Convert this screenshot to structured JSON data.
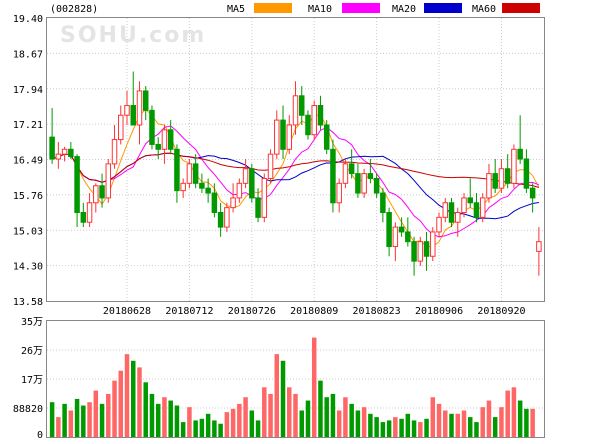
{
  "chart_data": [
    {
      "type": "candlestick",
      "code": "(002828)",
      "watermark": "SOHU.com",
      "legend": [
        {
          "name": "MA5",
          "color": "#ff9900"
        },
        {
          "name": "MA10",
          "color": "#ff00ff"
        },
        {
          "name": "MA20",
          "color": "#0000cc"
        },
        {
          "name": "MA60",
          "color": "#cc0000"
        }
      ],
      "ylim": [
        13.58,
        19.4
      ],
      "y_ticks": [
        "19.40",
        "18.67",
        "17.94",
        "17.21",
        "16.49",
        "15.76",
        "15.03",
        "14.30",
        "13.58"
      ],
      "x_tick_labels": [
        "20180628",
        "20180712",
        "20180726",
        "20180809",
        "20180823",
        "20180906",
        "20180920"
      ],
      "x_tick_index": [
        12,
        22,
        32,
        42,
        52,
        62,
        72
      ],
      "up_color": "#ff3333",
      "down_color": "#009900",
      "candles": [
        [
          16.95,
          17.55,
          16.4,
          16.5
        ],
        [
          16.5,
          16.85,
          16.3,
          16.6
        ],
        [
          16.6,
          16.75,
          16.45,
          16.7
        ],
        [
          16.7,
          16.85,
          16.5,
          16.55
        ],
        [
          16.55,
          16.6,
          15.1,
          15.4
        ],
        [
          15.4,
          15.6,
          15.1,
          15.2
        ],
        [
          15.2,
          15.8,
          15.1,
          15.6
        ],
        [
          15.6,
          16.0,
          15.4,
          15.95
        ],
        [
          15.95,
          16.2,
          15.5,
          15.7
        ],
        [
          15.7,
          16.5,
          15.6,
          16.4
        ],
        [
          16.4,
          17.2,
          16.3,
          16.9
        ],
        [
          16.9,
          17.6,
          16.8,
          17.4
        ],
        [
          17.4,
          17.9,
          17.2,
          17.6
        ],
        [
          17.6,
          18.3,
          17.2,
          17.2
        ],
        [
          17.2,
          18.1,
          16.8,
          17.9
        ],
        [
          17.9,
          18.0,
          17.3,
          17.5
        ],
        [
          17.5,
          17.6,
          16.7,
          16.8
        ],
        [
          16.8,
          16.95,
          16.5,
          16.7
        ],
        [
          16.7,
          17.2,
          16.4,
          17.1
        ],
        [
          17.1,
          17.3,
          16.6,
          16.7
        ],
        [
          16.7,
          16.8,
          15.6,
          15.85
        ],
        [
          15.85,
          16.1,
          15.7,
          16.0
        ],
        [
          16.0,
          16.5,
          15.9,
          16.4
        ],
        [
          16.4,
          16.6,
          15.9,
          16.0
        ],
        [
          16.0,
          16.2,
          15.8,
          15.9
        ],
        [
          15.9,
          16.1,
          15.6,
          15.8
        ],
        [
          15.8,
          16.0,
          15.3,
          15.4
        ],
        [
          15.4,
          15.6,
          14.9,
          15.1
        ],
        [
          15.1,
          15.6,
          15.0,
          15.5
        ],
        [
          15.5,
          16.0,
          15.4,
          15.7
        ],
        [
          15.7,
          16.1,
          15.6,
          16.0
        ],
        [
          16.0,
          16.5,
          15.9,
          16.3
        ],
        [
          16.3,
          16.4,
          15.6,
          15.7
        ],
        [
          15.7,
          15.9,
          15.2,
          15.3
        ],
        [
          15.3,
          16.2,
          15.2,
          16.1
        ],
        [
          16.1,
          16.7,
          16.0,
          16.6
        ],
        [
          16.6,
          17.5,
          16.5,
          17.3
        ],
        [
          17.3,
          17.6,
          16.5,
          16.7
        ],
        [
          16.7,
          17.4,
          16.6,
          17.2
        ],
        [
          17.2,
          18.1,
          17.0,
          17.8
        ],
        [
          17.8,
          18.0,
          17.2,
          17.4
        ],
        [
          17.4,
          17.5,
          16.9,
          17.0
        ],
        [
          17.0,
          17.7,
          16.9,
          17.6
        ],
        [
          17.6,
          17.8,
          17.1,
          17.2
        ],
        [
          17.2,
          17.3,
          16.6,
          16.7
        ],
        [
          16.7,
          16.9,
          15.4,
          15.6
        ],
        [
          15.6,
          16.1,
          15.4,
          16.0
        ],
        [
          16.0,
          16.5,
          15.9,
          16.4
        ],
        [
          16.4,
          16.7,
          16.1,
          16.2
        ],
        [
          16.2,
          16.4,
          15.7,
          15.8
        ],
        [
          15.8,
          16.3,
          15.7,
          16.2
        ],
        [
          16.2,
          16.5,
          16.0,
          16.1
        ],
        [
          16.1,
          16.2,
          15.7,
          15.8
        ],
        [
          15.8,
          15.9,
          15.2,
          15.4
        ],
        [
          15.4,
          15.5,
          14.5,
          14.7
        ],
        [
          14.7,
          15.2,
          14.4,
          15.1
        ],
        [
          15.1,
          15.3,
          14.9,
          15.0
        ],
        [
          15.0,
          15.3,
          14.7,
          14.8
        ],
        [
          14.8,
          14.9,
          14.1,
          14.4
        ],
        [
          14.4,
          14.9,
          14.3,
          14.8
        ],
        [
          14.8,
          15.0,
          14.2,
          14.5
        ],
        [
          14.5,
          15.1,
          14.4,
          15.0
        ],
        [
          15.0,
          15.4,
          14.9,
          15.3
        ],
        [
          15.3,
          15.7,
          15.2,
          15.6
        ],
        [
          15.6,
          15.7,
          15.1,
          15.2
        ],
        [
          15.2,
          15.5,
          14.9,
          15.4
        ],
        [
          15.4,
          15.8,
          15.3,
          15.7
        ],
        [
          15.7,
          16.1,
          15.5,
          15.6
        ],
        [
          15.6,
          15.8,
          15.2,
          15.3
        ],
        [
          15.3,
          15.8,
          15.2,
          15.7
        ],
        [
          15.7,
          16.4,
          15.6,
          16.2
        ],
        [
          16.2,
          16.5,
          15.8,
          15.9
        ],
        [
          15.9,
          16.5,
          15.8,
          16.3
        ],
        [
          16.3,
          16.6,
          15.9,
          16.0
        ],
        [
          16.0,
          16.8,
          15.9,
          16.7
        ],
        [
          16.7,
          17.4,
          16.4,
          16.5
        ],
        [
          16.5,
          16.7,
          15.8,
          15.9
        ],
        [
          15.9,
          16.0,
          15.4,
          15.7
        ],
        [
          14.6,
          15.1,
          14.1,
          14.8
        ]
      ],
      "vol_ylim": [
        0,
        350000
      ],
      "vol_ticks": [
        "35万",
        "26万",
        "17万",
        "88820",
        "0"
      ],
      "volume": [
        [
          0,
          105000
        ],
        [
          1,
          60000
        ],
        [
          0,
          100000
        ],
        [
          1,
          80000
        ],
        [
          0,
          115000
        ],
        [
          0,
          95000
        ],
        [
          1,
          105000
        ],
        [
          1,
          140000
        ],
        [
          0,
          100000
        ],
        [
          1,
          130000
        ],
        [
          1,
          170000
        ],
        [
          1,
          200000
        ],
        [
          1,
          250000
        ],
        [
          0,
          230000
        ],
        [
          1,
          210000
        ],
        [
          0,
          165000
        ],
        [
          0,
          130000
        ],
        [
          0,
          100000
        ],
        [
          1,
          120000
        ],
        [
          0,
          110000
        ],
        [
          0,
          95000
        ],
        [
          0,
          45000
        ],
        [
          1,
          90000
        ],
        [
          0,
          50000
        ],
        [
          0,
          55000
        ],
        [
          0,
          70000
        ],
        [
          0,
          50000
        ],
        [
          0,
          40000
        ],
        [
          1,
          75000
        ],
        [
          1,
          85000
        ],
        [
          1,
          100000
        ],
        [
          1,
          120000
        ],
        [
          0,
          80000
        ],
        [
          0,
          50000
        ],
        [
          1,
          150000
        ],
        [
          1,
          130000
        ],
        [
          1,
          250000
        ],
        [
          0,
          230000
        ],
        [
          1,
          150000
        ],
        [
          1,
          130000
        ],
        [
          0,
          80000
        ],
        [
          0,
          110000
        ],
        [
          1,
          300000
        ],
        [
          0,
          170000
        ],
        [
          0,
          120000
        ],
        [
          0,
          130000
        ],
        [
          1,
          80000
        ],
        [
          1,
          120000
        ],
        [
          0,
          100000
        ],
        [
          0,
          80000
        ],
        [
          1,
          90000
        ],
        [
          0,
          70000
        ],
        [
          0,
          60000
        ],
        [
          0,
          45000
        ],
        [
          0,
          50000
        ],
        [
          1,
          60000
        ],
        [
          0,
          55000
        ],
        [
          0,
          70000
        ],
        [
          0,
          50000
        ],
        [
          1,
          45000
        ],
        [
          0,
          55000
        ],
        [
          1,
          120000
        ],
        [
          1,
          100000
        ],
        [
          1,
          80000
        ],
        [
          0,
          70000
        ],
        [
          1,
          70000
        ],
        [
          1,
          80000
        ],
        [
          0,
          60000
        ],
        [
          0,
          45000
        ],
        [
          1,
          90000
        ],
        [
          1,
          110000
        ],
        [
          0,
          60000
        ],
        [
          1,
          90000
        ],
        [
          1,
          140000
        ],
        [
          1,
          150000
        ],
        [
          0,
          110000
        ],
        [
          0,
          85000
        ],
        [
          1,
          85000
        ]
      ]
    }
  ]
}
